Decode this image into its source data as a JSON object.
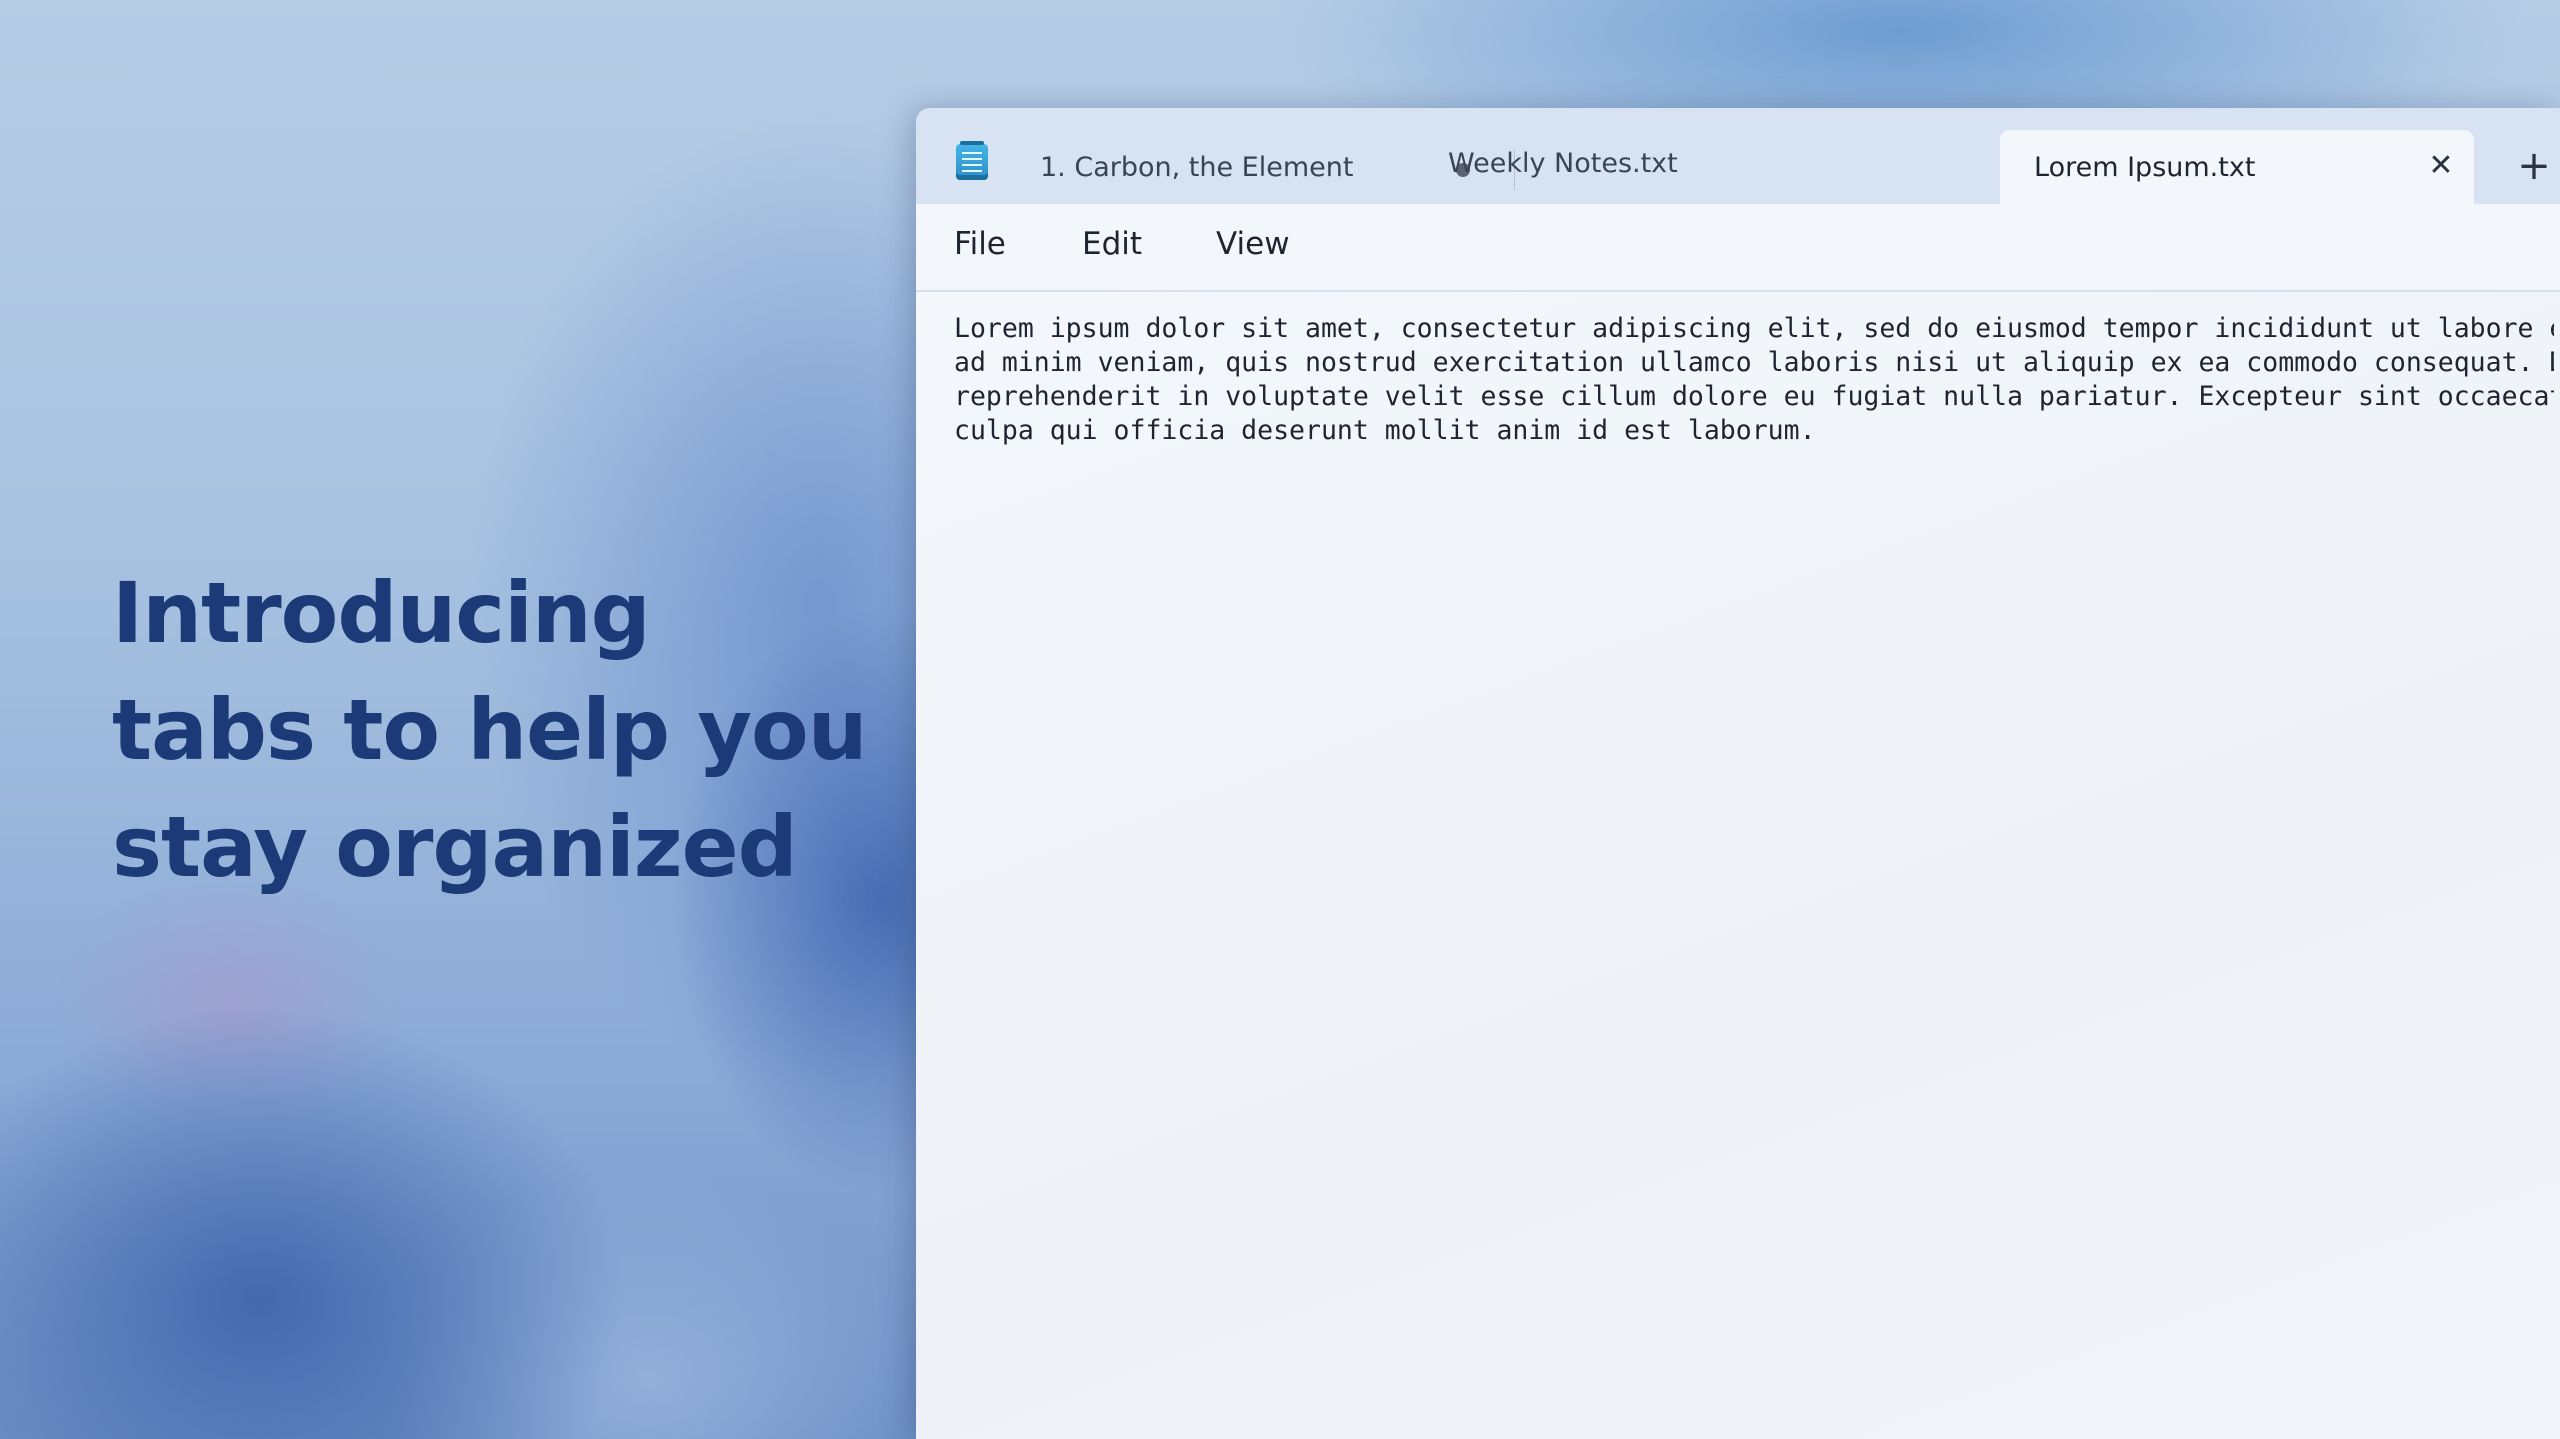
{
  "headline": "Introducing tabs to help you stay organized",
  "window": {
    "app_icon": "notepad-icon",
    "tabs": [
      {
        "label": "1. Carbon, the Element",
        "unsaved": true
      },
      {
        "label": "Weekly Notes.txt"
      },
      {
        "label": "Lorem Ipsum.txt",
        "active": true
      }
    ],
    "close_glyph": "✕",
    "new_tab_glyph": "+",
    "menu": {
      "file": "File",
      "edit": "Edit",
      "view": "View"
    },
    "editor_text": "Lorem ipsum dolor sit amet, consectetur adipiscing elit, sed do eiusmod tempor incididunt ut labore et\nad minim veniam, quis nostrud exercitation ullamco laboris nisi ut aliquip ex ea commodo consequat. D\nreprehenderit in voluptate velit esse cillum dolore eu fugiat nulla pariatur. Excepteur sint occaecat\nculpa qui officia deserunt mollit anim id est laborum."
  },
  "colors": {
    "headline": "#1c3a78",
    "tabstrip": "#d7e3f2",
    "active_tab": "#f3f7fc"
  }
}
